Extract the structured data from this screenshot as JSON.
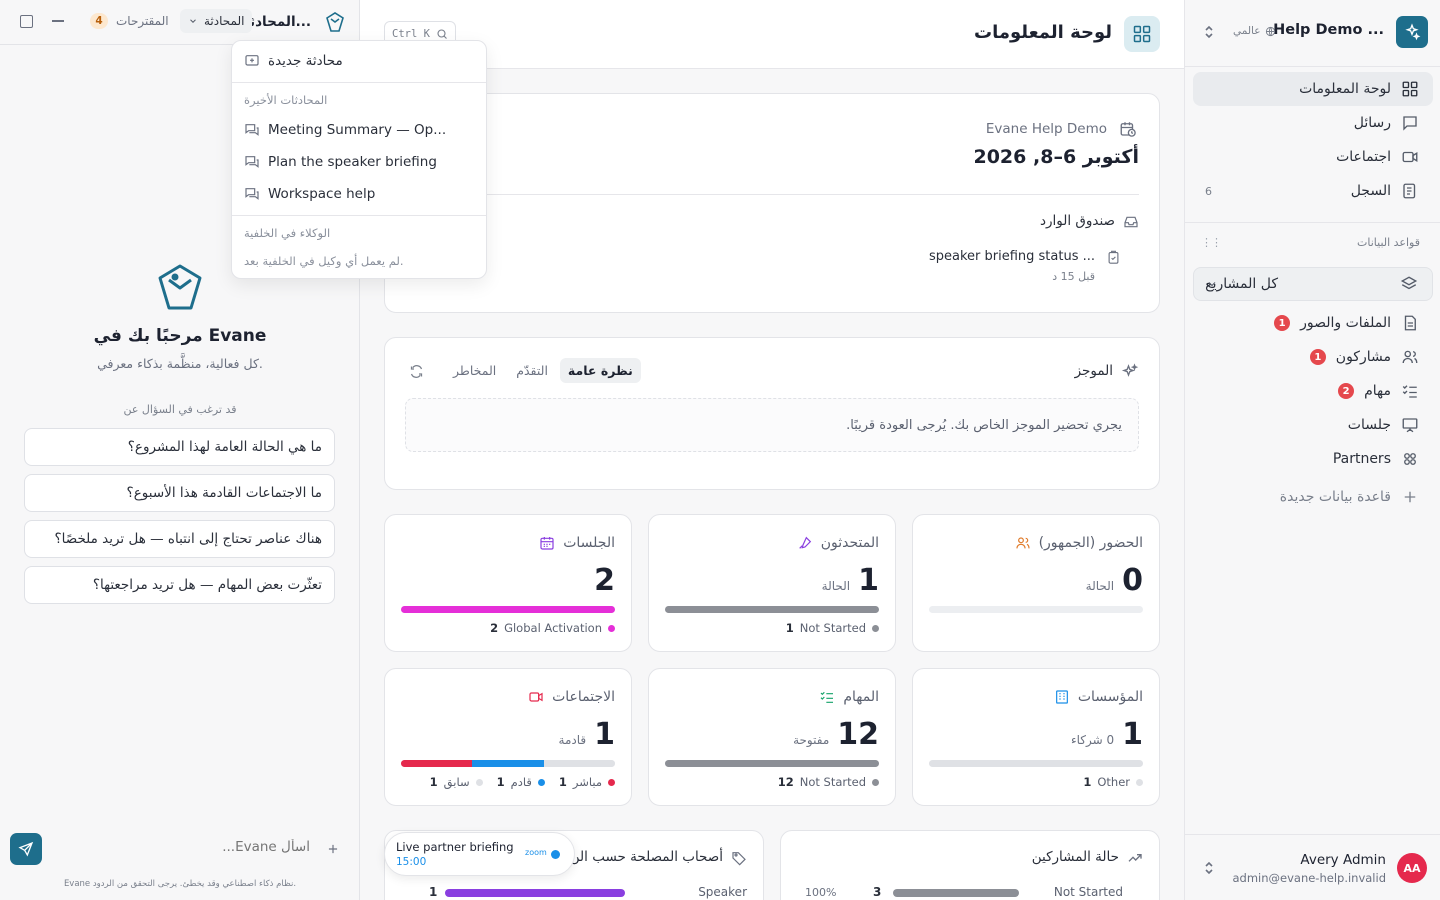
{
  "colors": {
    "accent": "#1e6e8c",
    "pink": "#e52fd8",
    "red": "#e5294d",
    "blue": "#1a8fe8",
    "grey": "#8c8f96",
    "badge": "#e5484d"
  },
  "sidebar": {
    "workspace_name": "Help Demo ...",
    "workspace_scope": "عالمي",
    "nav": [
      {
        "label": "لوحة المعلومات",
        "icon": "dashboard-icon",
        "active": true
      },
      {
        "label": "رسائل",
        "icon": "message-icon"
      },
      {
        "label": "اجتماعات",
        "icon": "video-icon"
      },
      {
        "label": "السجل",
        "icon": "log-icon",
        "count": "6"
      }
    ],
    "databases_heading": "قواعد البيانات",
    "all_projects": "كل المشاريع",
    "db_items": [
      {
        "label": "الملفات والصور",
        "icon": "file-icon",
        "badge": "1"
      },
      {
        "label": "مشاركون",
        "icon": "users-icon",
        "badge": "1"
      },
      {
        "label": "مهام",
        "icon": "tasks-icon",
        "badge": "2"
      },
      {
        "label": "جلسات",
        "icon": "presentation-icon"
      },
      {
        "label": "Partners",
        "icon": "partners-icon"
      }
    ],
    "new_database": "قاعدة بيانات جديدة",
    "user": {
      "name": "Avery Admin",
      "email": "admin@evane-help.invalid",
      "initials": "AA"
    }
  },
  "header": {
    "title": "لوحة المعلومات",
    "search_shortcut": "Ctrl K"
  },
  "event_card": {
    "org": "Evane Help Demo",
    "date": "أكتوبر 6–8, 2026",
    "inbox_label": "صندوق الوارد",
    "inbox_item": "speaker briefing status ...",
    "inbox_time": "قبل 15 د"
  },
  "brief": {
    "title": "الموجز",
    "tabs": [
      "نظرة عامة",
      "التقدّم",
      "المخاطر"
    ],
    "active_tab": 0,
    "message": "يجري تحضير الموجز الخاص بك. يُرجى العودة قريبًا."
  },
  "stats": [
    {
      "title": "الحضور (الجمهور)",
      "value": "0",
      "sub": "الحالة",
      "icon": "audience-icon",
      "icon_color": "#e07b2a",
      "segments": [],
      "legend": []
    },
    {
      "title": "المتحدثون",
      "value": "1",
      "sub": "الحالة",
      "icon": "mic-icon",
      "icon_color": "#8a3fe0",
      "segments": [
        {
          "fraction": 1,
          "color": "#8c8f96"
        }
      ],
      "legend": [
        {
          "label": "Not Started",
          "count": "1",
          "color": "#8c8f96"
        }
      ]
    },
    {
      "title": "الجلسات",
      "value": "2",
      "sub": "",
      "icon": "calendar-icon",
      "icon_color": "#8a3fe0",
      "segments": [
        {
          "fraction": 1,
          "color": "#e52fd8"
        }
      ],
      "legend": [
        {
          "label": "Global Activation",
          "count": "2",
          "color": "#e52fd8"
        }
      ]
    },
    {
      "title": "المؤسسات",
      "value": "1",
      "sub": "0 شركاء",
      "icon": "building-icon",
      "icon_color": "#1a8fe8",
      "segments": [
        {
          "fraction": 1,
          "color": "#dfe1e5"
        }
      ],
      "legend": [
        {
          "label": "Other",
          "count": "1",
          "color": "#dfe1e5"
        }
      ]
    },
    {
      "title": "المهام",
      "value": "12",
      "sub": "مفتوحة",
      "icon": "checklist-icon",
      "icon_color": "#16a36a",
      "segments": [
        {
          "fraction": 1,
          "color": "#8c8f96"
        }
      ],
      "legend": [
        {
          "label": "Not Started",
          "count": "12",
          "color": "#8c8f96"
        }
      ]
    },
    {
      "title": "الاجتماعات",
      "value": "1",
      "sub": "قادمة",
      "icon": "video-icon",
      "icon_color": "#e5294d",
      "segments": [
        {
          "fraction": 0.333,
          "color": "#e5294d"
        },
        {
          "fraction": 0.333,
          "color": "#1a8fe8"
        },
        {
          "fraction": 0.334,
          "color": "#dfe1e5"
        }
      ],
      "legend": [
        {
          "label": "مباشر",
          "count": "1",
          "color": "#e5294d"
        },
        {
          "label": "قادم",
          "count": "1",
          "color": "#1a8fe8"
        },
        {
          "label": "سابق",
          "count": "1",
          "color": "#dfe1e5"
        }
      ]
    }
  ],
  "bottom_cards": {
    "participants": {
      "title": "حالة المشاركين",
      "label": "Not Started",
      "count": "3",
      "percent": "100%",
      "fill": 1
    },
    "stakeholders": {
      "title": "أصحاب المصلحة حسب الن",
      "label": "Speaker",
      "count": "1",
      "fill": 1
    }
  },
  "live_toast": {
    "title": "Live partner briefing",
    "time": "15:00",
    "app": "zoom"
  },
  "chat": {
    "title": "المحادثا...",
    "conversation_menu": "المحادثة",
    "suggestions_tab": "المقترحات",
    "suggestions_count": "4",
    "welcome_title": "مرحبًا بك في Evane",
    "welcome_sub": "كل فعالية، منظَّمة بذكاء معرفي.",
    "ask_heading": "قد ترغب في السؤال عن",
    "suggestions": [
      "ما هي الحالة العامة لهذا المشروع؟",
      "ما الاجتماعات القادمة هذا الأسبوع؟",
      "هناك عناصر تحتاج إلى انتباه — هل تريد ملخصًا؟",
      "تعثّرت بعض المهام — هل تريد مراجعتها؟"
    ],
    "input_placeholder": "اسأل Evane...",
    "disclaimer": "Evane نظام ذكاء اصطناعي وقد يخطئ. يرجى التحقق من الردود."
  },
  "dropdown": {
    "new_chat": "محادثة جديدة",
    "recent_heading": "المحادثات الأخيرة",
    "recent": [
      "Meeting Summary — Op...",
      "Plan the speaker briefing",
      "Workspace help"
    ],
    "agents_heading": "الوكلاء في الخلفية",
    "agents_empty": "لم يعمل أي وكيل في الخلفية بعد."
  }
}
